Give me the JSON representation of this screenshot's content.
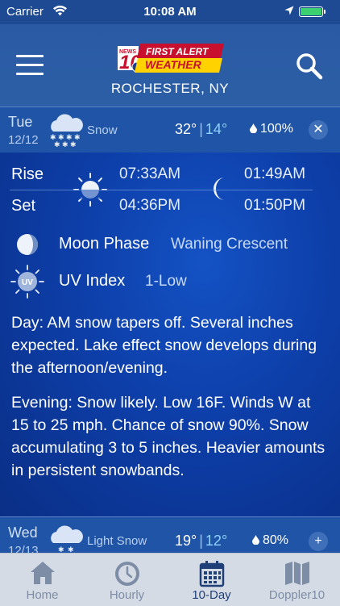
{
  "status_bar": {
    "carrier": "Carrier",
    "time": "10:08 AM"
  },
  "header": {
    "logo_channel": "10",
    "logo_line1": "FIRST ALERT",
    "logo_line2": "WEATHER",
    "logo_news": "NEWS",
    "location": "ROCHESTER, NY"
  },
  "days": [
    {
      "dow": "Tue",
      "date": "12/12",
      "condition": "Snow",
      "high": "32°",
      "low": "14°",
      "precip": "100%",
      "expanded": true,
      "toggle_glyph": "✕",
      "icon": "snow-cloud-icon"
    },
    {
      "dow": "Wed",
      "date": "12/13",
      "condition": "Light Snow",
      "high": "19°",
      "low": "12°",
      "precip": "80%",
      "expanded": false,
      "toggle_glyph": "+",
      "icon": "light-snow-cloud-icon"
    }
  ],
  "detail": {
    "rise_label": "Rise",
    "set_label": "Set",
    "sunrise": "07:33AM",
    "sunset": "04:36PM",
    "moonrise": "01:49AM",
    "moonset": "01:50PM",
    "moon_phase_label": "Moon Phase",
    "moon_phase_value": "Waning Crescent",
    "uv_label": "UV Index",
    "uv_value": "1-Low",
    "uv_badge": "UV",
    "day_text": "Day: AM snow tapers off.  Several inches expected.  Lake effect snow develops during the afternoon/evening.",
    "evening_text": "Evening: Snow likely. Low 16F. Winds W at 15 to 25 mph. Chance of snow 90%. Snow accumulating 3 to 5 inches. Heavier amounts in persistent snowbands."
  },
  "tabs": [
    {
      "label": "Home",
      "icon": "home-icon",
      "active": false
    },
    {
      "label": "Hourly",
      "icon": "clock-icon",
      "active": false
    },
    {
      "label": "10-Day",
      "icon": "calendar-icon",
      "active": true
    },
    {
      "label": "Doppler10",
      "icon": "map-icon",
      "active": false
    }
  ],
  "colors": {
    "background": "#0a2f86",
    "header": "#2c5fa6",
    "low_temp": "#8ed2ff",
    "tab_active": "#1f3f79",
    "tab_inactive": "#7d8da6",
    "battery": "#3cd070"
  }
}
